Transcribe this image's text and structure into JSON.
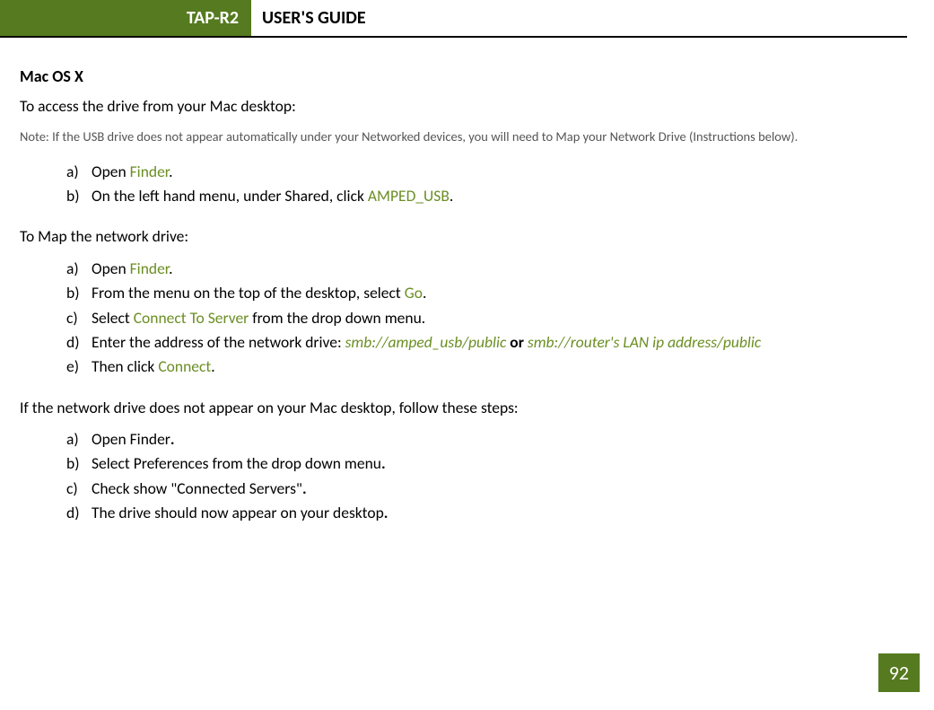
{
  "header": {
    "badge": "TAP-R2",
    "title": "USER'S GUIDE"
  },
  "page_number": "92",
  "section1": {
    "heading": "Mac OS X",
    "intro": "To access the drive from your Mac desktop:",
    "note": "Note: If the USB drive does not appear automatically under your Networked devices, you will need to Map your Network Drive (Instructions below).",
    "list": {
      "a": {
        "marker": "a)",
        "pre": "Open ",
        "hl": "Finder",
        "post": "."
      },
      "b": {
        "marker": "b)",
        "pre": "On the left hand menu, under Shared, click ",
        "hl": "AMPED_USB",
        "post": "."
      }
    }
  },
  "section2": {
    "intro": "To Map the network drive:",
    "list": {
      "a": {
        "marker": "a)",
        "pre": "Open ",
        "hl": "Finder",
        "post": "."
      },
      "b": {
        "marker": "b)",
        "pre": "From the menu on the top of the desktop, select ",
        "hl": "Go",
        "post": "."
      },
      "c": {
        "marker": "c)",
        "pre": "Select ",
        "hl": "Connect To Server",
        "post": " from the drop down menu."
      },
      "d": {
        "marker": "d)",
        "pre": "Enter the address of the network drive: ",
        "hl1": "smb://amped_usb/public",
        "mid": " or ",
        "hl2": "smb://router's LAN ip address/public"
      },
      "e": {
        "marker": "e)",
        "pre": "Then click ",
        "hl": "Connect",
        "post": "."
      }
    }
  },
  "section3": {
    "intro": "If the network drive does not appear on your Mac desktop, follow these steps:",
    "list": {
      "a": {
        "marker": "a)",
        "text": "Open Finder",
        "dot": "."
      },
      "b": {
        "marker": "b)",
        "text": "Select Preferences from the drop down menu",
        "dot": "."
      },
      "c": {
        "marker": "c)",
        "text": "Check show \"Connected Servers\"",
        "dot": "."
      },
      "d": {
        "marker": "d)",
        "text": "The drive should now appear on your desktop",
        "dot": "."
      }
    }
  }
}
